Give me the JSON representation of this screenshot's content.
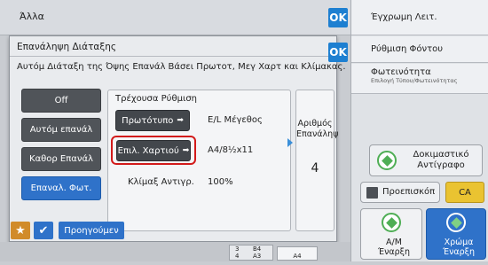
{
  "background": {
    "title": "Άλλα",
    "ok_label": "OK"
  },
  "right_column": {
    "play_glyph": "▶",
    "items": [
      {
        "label": "Έγχρωμη Λειτ."
      },
      {
        "label": "Ρύθμιση Φόντου"
      },
      {
        "label": "Φωτεινότητα",
        "sub": "Επιλογή Τύπου/Φωτεινότητας"
      }
    ],
    "sample_copy_label": "Δοκιμαστικό Αντίγραφο",
    "preview_label": "Προεπισκόπ",
    "ca_label": "CA",
    "bw_start_label": "A/M Έναρξη",
    "color_start_label": "Χρώμα Έναρξη"
  },
  "dialog": {
    "title": "Επανάληψη Διάταξης",
    "ok_label": "OK",
    "description": "Αυτόμ Διάταξη της Όψης Επανάλ Βάσει Πρωτοτ, Μεγ Χαρτ και Κλίμακας.",
    "modes": [
      {
        "label": "Off",
        "active": false
      },
      {
        "label": "Αυτόμ επανάλ",
        "active": false
      },
      {
        "label": "Καθορ Επανάλ",
        "active": false
      },
      {
        "label": "Επαναλ. Φωτ.",
        "active": true
      }
    ],
    "current_setting": {
      "title": "Τρέχουσα Ρύθμιση",
      "original_button": "Πρωτότυπο",
      "original_value": "E/L Μέγεθος",
      "paper_button": "Επιλ. Χαρτιού",
      "paper_value": "A4/8½x11",
      "scale_label": "Κλίμαξ Αντιγρ.",
      "scale_value": "100%"
    },
    "repeat_count": {
      "label": "Αριθμός Επανάληψ",
      "value": "4"
    }
  },
  "bottom": {
    "star_glyph": "★",
    "check_glyph": "✔",
    "previous_label": "Προηγούμεν",
    "tray_rows": [
      {
        "num": "3",
        "size": "B4"
      },
      {
        "num": "4",
        "size": "A3"
      }
    ],
    "tray_extra": "A4"
  },
  "colors": {
    "accent": "#2f72c9",
    "highlight": "#d21a1a",
    "start_green": "#4fae55"
  }
}
